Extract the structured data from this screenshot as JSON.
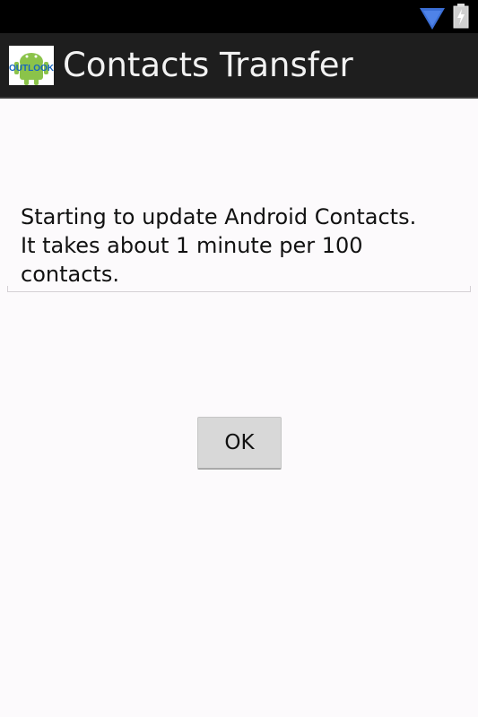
{
  "status_bar": {
    "wifi_icon": "wifi-icon",
    "battery_icon": "battery-icon",
    "background": "#000000",
    "icon_color": "#3b6fd6"
  },
  "title_bar": {
    "app_icon": "outlook-android-app-icon",
    "app_icon_text": "OUTLOOK",
    "title": "Contacts Transfer",
    "background": "#1e1e1e"
  },
  "message": {
    "lines": [
      "Starting to update Android Contacts.",
      "It takes about 1 minute per 100",
      "contacts."
    ]
  },
  "button": {
    "ok_label": "OK"
  },
  "colors": {
    "screen_background": "#fcfafc",
    "text": "#111111",
    "button_background": "#d8d8d8"
  }
}
